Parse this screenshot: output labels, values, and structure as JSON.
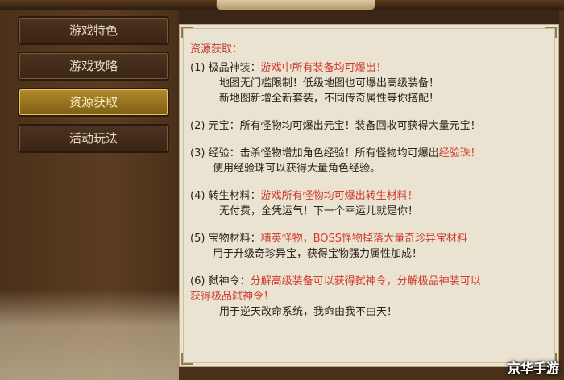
{
  "tabs": [
    {
      "label": "游戏特色",
      "active": false
    },
    {
      "label": "游戏攻略",
      "active": false
    },
    {
      "label": "资源获取",
      "active": true
    },
    {
      "label": "活动玩法",
      "active": false
    }
  ],
  "content": {
    "heading": "资源获取：",
    "items": [
      {
        "num": "(1)",
        "label": "极品神装：",
        "highlight": "游戏中所有装备均可爆出！",
        "lines": [
          "地图无门槛限制！低级地图也可爆出高级装备！",
          "新地图新增全新套装，不同传奇属性等你搭配！"
        ]
      },
      {
        "num": "(2)",
        "label": "元宝：",
        "text": "所有怪物均可爆出元宝！装备回收可获得大量元宝！"
      },
      {
        "num": "(3)",
        "label": "经验：",
        "text": "击杀怪物增加角色经验！所有怪物均可爆出",
        "highlight": "经验珠！",
        "lines": [
          "使用经验珠可以获得大量角色经验。"
        ]
      },
      {
        "num": "(4)",
        "label": "转生材料：",
        "highlight": "游戏所有怪物均可爆出转生材料！",
        "lines": [
          "无付费，全凭运气！下一个幸运儿就是你！"
        ]
      },
      {
        "num": "(5)",
        "label": "宝物材料：",
        "highlight": "精英怪物，BOSS怪物掉落大量奇珍异宝材料",
        "lines": [
          "用于升级奇珍异宝，获得宝物强力属性加成！"
        ]
      },
      {
        "num": "(6)",
        "label": "弑神令：",
        "highlight": "分解高级装备可以获得弑神令，分解极品神装可以",
        "highlight2": "获得极品弑神令！",
        "lines": [
          "用于逆天改命系统，我命由我不由天！"
        ]
      }
    ]
  },
  "watermark": "京华手游"
}
